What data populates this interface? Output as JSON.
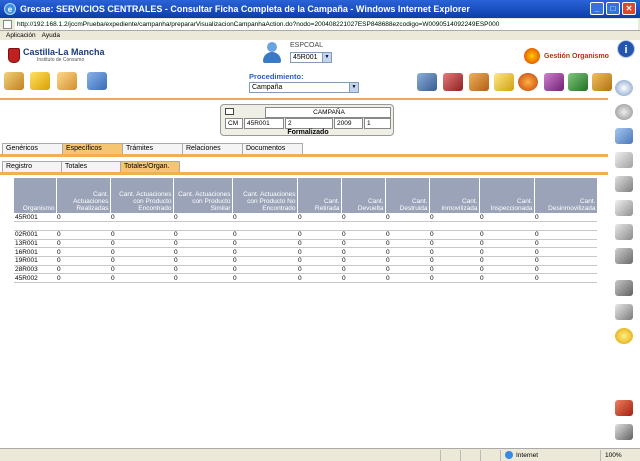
{
  "window": {
    "title": "Grecae: SERVICIOS CENTRALES - Consultar Ficha Completa de la Campaña - Windows Internet Explorer",
    "url": "http://192.168.1.2/jccmPrueba/expediente/campanha/prepararVisualizacionCampanhaAction.do?nodo=200408221027ESP848688ezcodigo=W0090514092249ESP000"
  },
  "menu": {
    "items": [
      "Aplicación",
      "Ayuda"
    ]
  },
  "header": {
    "logo_name": "Castilla-La Mancha",
    "logo_sub": "Instituto de Consumo",
    "user_label": "ESPCOAL",
    "user_select": "45R001",
    "gestion_label": "Gestión Organismo",
    "procedimiento_label": "Procedimiento:",
    "procedimiento_value": "Campaña"
  },
  "campaign": {
    "title": "CAMPAÑA",
    "code": "CM",
    "organismo": "45R001",
    "number": "2",
    "year": "2009",
    "seq": "1",
    "status": "Formalizado"
  },
  "tabs_main": [
    "Genéricos",
    "Específicos",
    "Trámites",
    "Relaciones",
    "Documentos"
  ],
  "tabs_sub": [
    "Registro",
    "Totales",
    "Totales/Organ."
  ],
  "grid": {
    "headers": [
      "Organismo",
      "Cant. Actuaciones Realizadas",
      "Cant. Actuaciones con Producto Encontrado",
      "Cant. Actuaciones con Producto Similar",
      "Cant. Actuaciones con Producto No Encontrado",
      "Cant. Retirada",
      "Cant. Devuelta",
      "Cant. Destruida",
      "Cant. Inmovilizada",
      "Cant. Inspeccionada",
      "Cant. Desinmovilizada"
    ],
    "rows": [
      [
        "45R001",
        "0",
        "0",
        "0",
        "0",
        "0",
        "0",
        "0",
        "0",
        "0",
        "0"
      ],
      [
        "",
        "",
        "",
        "",
        "",
        "",
        "",
        "",
        "",
        "",
        ""
      ],
      [
        "02R001",
        "0",
        "0",
        "0",
        "0",
        "0",
        "0",
        "0",
        "0",
        "0",
        "0"
      ],
      [
        "13R001",
        "0",
        "0",
        "0",
        "0",
        "0",
        "0",
        "0",
        "0",
        "0",
        "0"
      ],
      [
        "16R001",
        "0",
        "0",
        "0",
        "0",
        "0",
        "0",
        "0",
        "0",
        "0",
        "0"
      ],
      [
        "19R001",
        "0",
        "0",
        "0",
        "0",
        "0",
        "0",
        "0",
        "0",
        "0",
        "0"
      ],
      [
        "28R003",
        "0",
        "0",
        "0",
        "0",
        "0",
        "0",
        "0",
        "0",
        "0",
        "0"
      ],
      [
        "45R002",
        "0",
        "0",
        "0",
        "0",
        "0",
        "0",
        "0",
        "0",
        "0",
        "0"
      ]
    ]
  },
  "statusbar": {
    "zone": "Internet",
    "zoom": "100%"
  },
  "colors": {
    "titlebar": "#0c3ea8",
    "active_tab": "#f5c572",
    "grid_header": "#9aa3b8",
    "tab_line": "#f0b050"
  }
}
